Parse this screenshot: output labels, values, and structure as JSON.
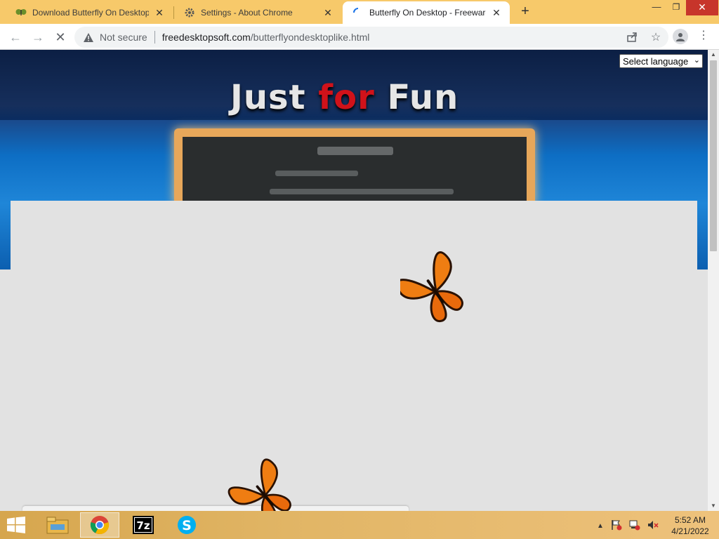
{
  "tabs": [
    {
      "title": "Download Butterfly On Desktop -",
      "icon": "butterfly-favicon-icon"
    },
    {
      "title": "Settings - About Chrome",
      "icon": "gear-icon"
    },
    {
      "title": "Butterfly On Desktop - Freeware",
      "icon": "loading-spinner-icon",
      "active": true
    }
  ],
  "toolbar": {
    "security_label": "Not secure",
    "url_host": "freedesktopsoft.com",
    "url_path": "/butterflyondesktoplike.html"
  },
  "page": {
    "logo_word1": "Just",
    "logo_word2": "for",
    "logo_word3": "Fun",
    "language_select": "Select language"
  },
  "taskbar": {
    "time": "5:52 AM",
    "date": "4/21/2022",
    "apps": [
      "file-explorer-icon",
      "chrome-icon",
      "7zip-icon",
      "skype-icon"
    ]
  },
  "colors": {
    "tabstrip": "#f7c96a",
    "banner_blue": "#1a4a8c",
    "logo_red": "#d0121a",
    "close_button": "#c7352b"
  }
}
